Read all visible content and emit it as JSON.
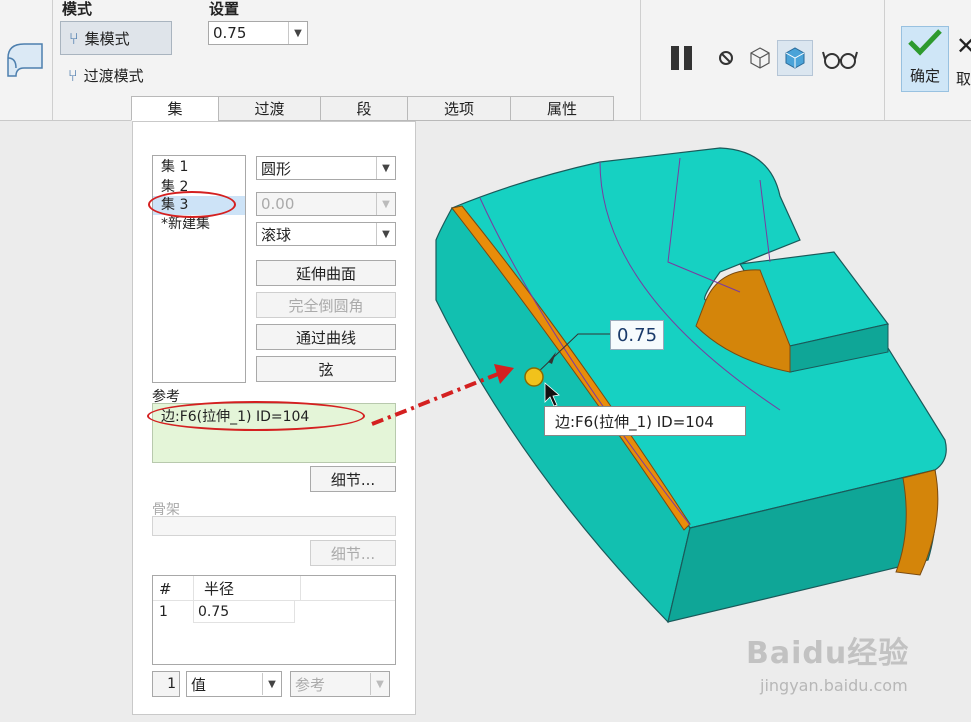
{
  "ribbon": {
    "mode_group_title": "模式",
    "set_mode_label": "集模式",
    "transition_mode_label": "过渡模式",
    "settings_group_title": "设置",
    "settings_value": "0.75",
    "confirm_label": "确定",
    "cancel_label": "取"
  },
  "tabs": [
    "集",
    "过渡",
    "段",
    "选项",
    "属性"
  ],
  "panel": {
    "sets": [
      "集 1",
      "集 2",
      "集 3",
      "*新建集"
    ],
    "shape_value": "圆形",
    "value_disabled": "0.00",
    "method_value": "滚球",
    "buttons": {
      "extend_surfaces": "延伸曲面",
      "full_round": "完全倒圆角",
      "through_curve": "通过曲线",
      "chord": "弦"
    },
    "references_label": "参考",
    "reference_item": "边:F6(拉伸_1) ID=104",
    "details_label": "细节...",
    "skeleton_label": "骨架",
    "radius_table": {
      "headers": [
        "#",
        "半径"
      ],
      "rows": [
        [
          "1",
          "0.75"
        ]
      ]
    },
    "footer_index": "1",
    "footer_value_type": "值",
    "footer_ref": "参考"
  },
  "viewport": {
    "dimension_value": "0.75",
    "tooltip": "边:F6(拉伸_1) ID=104"
  },
  "watermark": {
    "logo": "Baidu经验",
    "url": "jingyan.baidu.com"
  }
}
